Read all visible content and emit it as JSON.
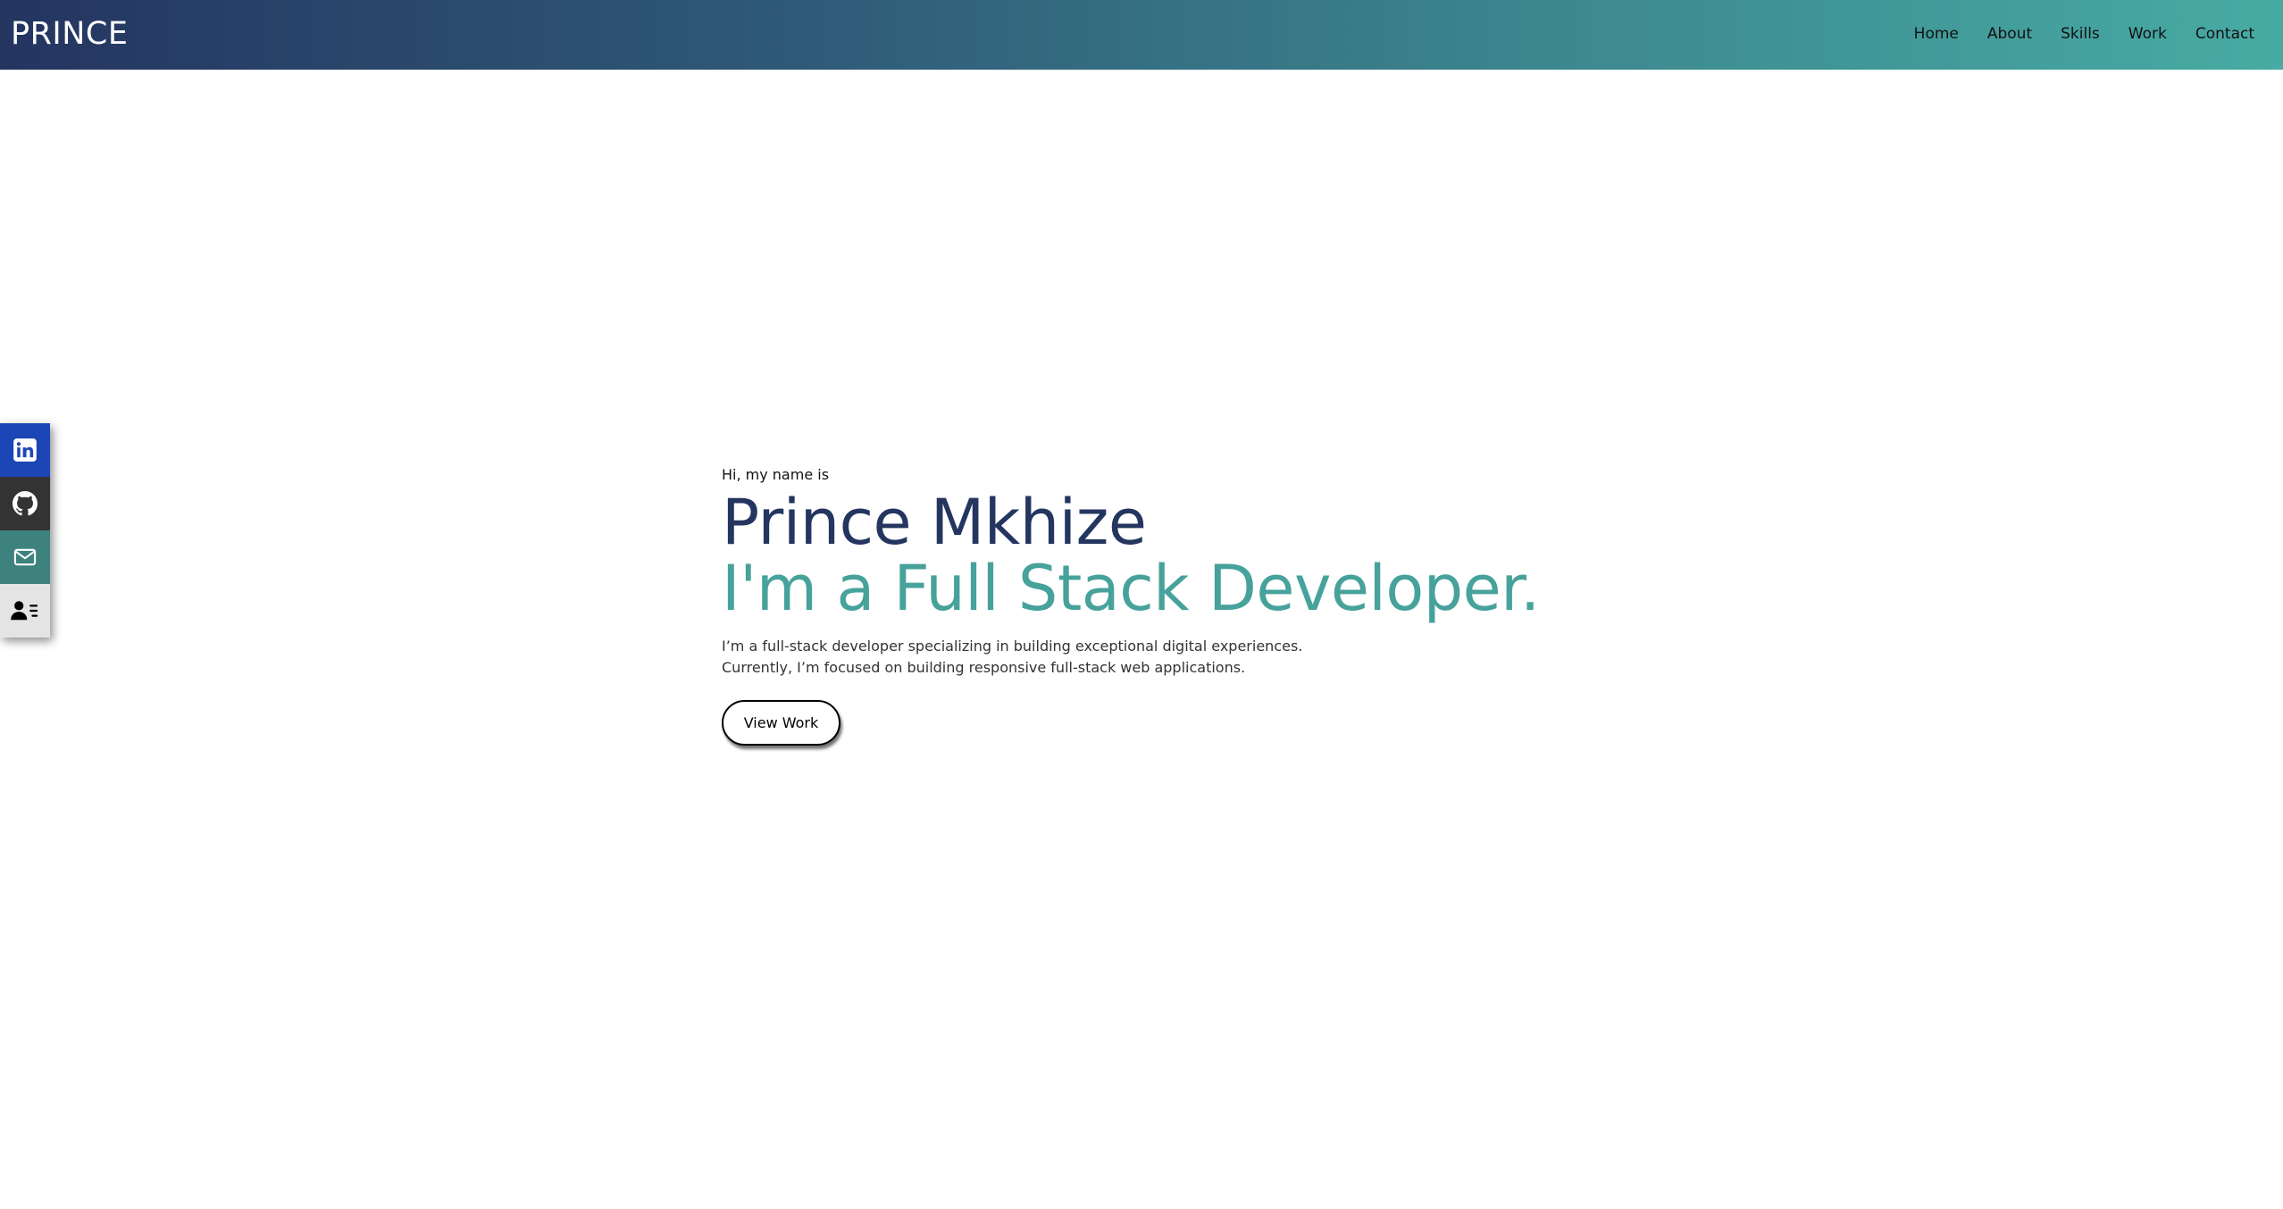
{
  "header": {
    "logo": "PRINCE",
    "nav": [
      "Home",
      "About",
      "Skills",
      "Work",
      "Contact"
    ]
  },
  "social": [
    {
      "name": "linkedin",
      "icon": "linkedin-icon",
      "color": "#1c46b5"
    },
    {
      "name": "github",
      "icon": "github-icon",
      "color": "#333333"
    },
    {
      "name": "email",
      "icon": "mail-icon",
      "color": "#3e827e"
    },
    {
      "name": "resume",
      "icon": "resume-icon",
      "color": "#e4e4e4"
    }
  ],
  "hero": {
    "greeting": "Hi, my name is",
    "name": "Prince Mkhize",
    "role": "I'm a Full Stack Developer.",
    "desc_line1": "I’m a full-stack developer specializing in building exceptional digital experiences.",
    "desc_line2": "Currently, I’m focused on building responsive full-stack web applications.",
    "cta": "View Work"
  },
  "colors": {
    "name": "#243560",
    "role": "#47a29b",
    "nav_start": "#243560",
    "nav_end": "#47aba3"
  }
}
